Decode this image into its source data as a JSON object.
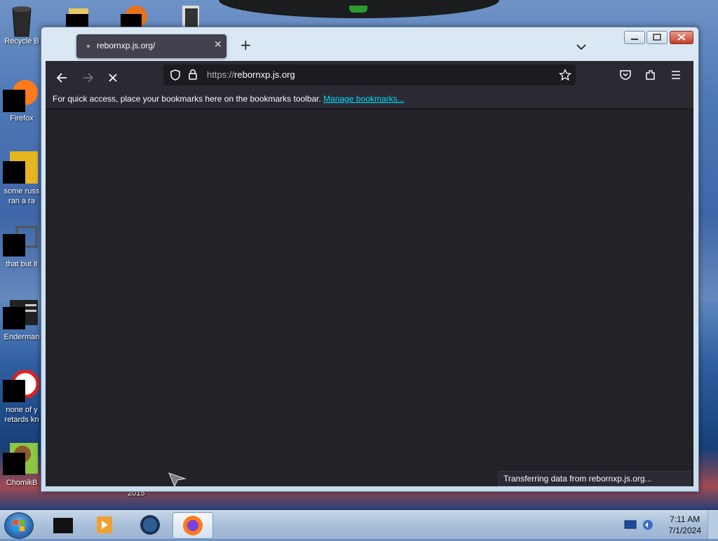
{
  "desktop": {
    "icons": [
      {
        "label": "Recycle B"
      },
      {
        "label": "Firefox"
      },
      {
        "label": "some russ",
        "label2": "ran a ra"
      },
      {
        "label": "that but it"
      },
      {
        "label": "Enderman"
      },
      {
        "label": "none of y",
        "label2": "retards kn"
      },
      {
        "label": "ChomikB"
      }
    ],
    "stray_label": "2015"
  },
  "browser": {
    "tab": {
      "title": "rebornxp.js.org/"
    },
    "url": {
      "protocol": "https://",
      "host": "rebornxp.js.org"
    },
    "bookmarks_bar": {
      "message": "For quick access, place your bookmarks here on the bookmarks toolbar.",
      "link": "Manage bookmarks..."
    },
    "status_text": "Transferring data from rebornxp.js.org..."
  },
  "taskbar": {
    "time": "7:11 AM",
    "date": "7/1/2024"
  },
  "colors": {
    "toolbar": "#2b2a33",
    "content": "#232229",
    "link": "#00ddff"
  }
}
